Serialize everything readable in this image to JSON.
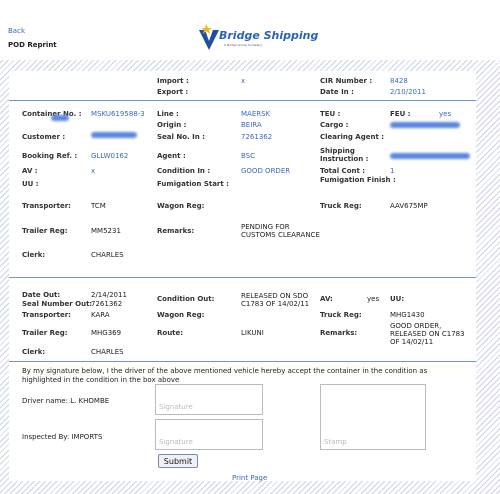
{
  "nav": {
    "back": "Back",
    "title": "POD Reprint"
  },
  "brand": {
    "name": "Bridge Shipping",
    "tagline": "A Bridge Group Company"
  },
  "rows": {
    "import_label": "Import :",
    "import_value": "x",
    "export_label": "Export :",
    "cir_label": "CIR Number :",
    "cir_value": "8428",
    "datein_label": "Date In :",
    "datein_value": "2/10/2011",
    "container_label": "Container No. :",
    "container_value": "MSKU619588-3",
    "line_label": "Line :",
    "line_value": "MAERSK",
    "teu_label": "TEU :",
    "feu_label": "FEU :",
    "feu_value": "yes",
    "origin_label": "Origin :",
    "origin_value": "BEIRA",
    "cargo_label": "Cargo :",
    "customer_label": "Customer :",
    "seal_label": "Seal No. In :",
    "seal_value": "7261362",
    "clearing_label": "Clearing Agent :",
    "booking_label": "Booking Ref. :",
    "booking_value": "GLLW0162",
    "agent_label": "Agent :",
    "agent_value": "BSC",
    "shipping_label": "Shipping Instruction :",
    "av_label": "AV :",
    "av_value": "x",
    "condition_in_label": "Condition In :",
    "condition_in_value": "GOOD ORDER",
    "total_label": "Total Cont :",
    "total_value": "1",
    "uu_label": "UU :",
    "fum_start_label": "Fumigation Start :",
    "fum_finish_label": "Fumigation Finish :",
    "transporter_label": "Transporter:",
    "transporter_value": "TCM",
    "wagon_label": "Wagon Reg:",
    "truck_label": "Truck Reg:",
    "truck_value": "AAV675MP",
    "trailer_label": "Trailer Reg:",
    "trailer_value": "MM5231",
    "remarks_label": "Remarks:",
    "remarks_value": "PENDING FOR CUSTOMS CLEARANCE",
    "clerk_label": "Clerk:",
    "clerk_value": "CHARLES"
  },
  "out": {
    "dateout_label": "Date Out:",
    "dateout_value": "2/14/2011",
    "sealout_label": "Seal Number Out:",
    "sealout_value": "7261362",
    "condition_out_label": "Condition Out:",
    "condition_out_value": "RELEASED ON SDO C1783 OF 14/02/11",
    "av_label": "AV:",
    "av_value": "yes",
    "uu_label": "UU:",
    "transporter_label": "Transporter:",
    "transporter_value": "KARA",
    "wagon_label": "Wagon Reg:",
    "truck_label": "Truck Reg:",
    "truck_value": "MHG1430",
    "trailer_label": "Trailer Reg:",
    "trailer_value": "MHG369",
    "route_label": "Route:",
    "route_value": "LIKUNI",
    "remarks_label": "Remarks:",
    "remarks_value": "GOOD ORDER, RELEASED ON C1783 OF 14/02/11",
    "clerk_label": "Clerk:",
    "clerk_value": "CHARLES"
  },
  "signature": {
    "statement": "By my signature below, I the driver of the above mentioned vehicle hereby accept the container in the condition as highlighted in the condition in the box above",
    "driver_label": "Driver name: L. KHOMBE",
    "inspected_label": "Inspected By: IMPORTS",
    "sig_placeholder": "Signature",
    "stamp_placeholder": "Stamp",
    "submit": "Submit"
  },
  "footer": {
    "print": "Print Page"
  },
  "colors": {
    "accent": "#3a67c4",
    "divider": "#6d95dd",
    "redacted": "#5a86e0"
  }
}
